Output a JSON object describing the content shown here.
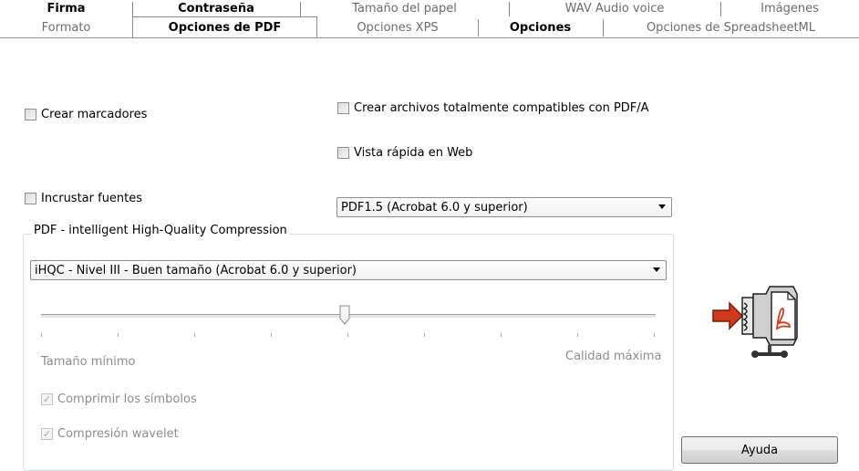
{
  "tabs_row1": [
    {
      "label": "Firma",
      "bold": true
    },
    {
      "label": "Contraseña",
      "bold": true
    },
    {
      "label": "Tamaño del papel",
      "bold": false
    },
    {
      "label": "WAV Audio voice",
      "bold": false
    },
    {
      "label": "Imágenes",
      "bold": false
    }
  ],
  "tabs_row2": [
    {
      "label": "Formato"
    },
    {
      "label": "Opciones de PDF",
      "active": true
    },
    {
      "label": "Opciones XPS"
    },
    {
      "label": "Opciones"
    },
    {
      "label": "Opciones de SpreadsheetML"
    }
  ],
  "options": {
    "crear_marcadores": {
      "label": "Crear marcadores",
      "checked": false
    },
    "pdfa": {
      "label": "Crear archivos totalmente compatibles con PDF/A",
      "checked": false
    },
    "vista_rapida": {
      "label": "Vista rápida en Web",
      "checked": false
    },
    "incrustar_fuentes": {
      "label": "Incrustar fuentes",
      "checked": false
    }
  },
  "pdf_version": {
    "selected": "PDF1.5 (Acrobat 6.0 y superior)"
  },
  "compression": {
    "group_label": "PDF - intelligent High-Quality Compression",
    "selected": "iHQC - Nivel III - Buen tamaño (Acrobat 6.0 y superior)",
    "slider_level": 0.5,
    "min_label": "Tamaño mínimo",
    "max_label": "Calidad máxima",
    "comprimir_simbolos": {
      "label": "Comprimir los símbolos",
      "checked": true
    },
    "compresion_wavelet": {
      "label": "Compresión wavelet",
      "checked": true
    }
  },
  "help_button": {
    "label": "Ayuda"
  },
  "icons": {
    "illustration": "pdf-compression-vise-icon"
  }
}
